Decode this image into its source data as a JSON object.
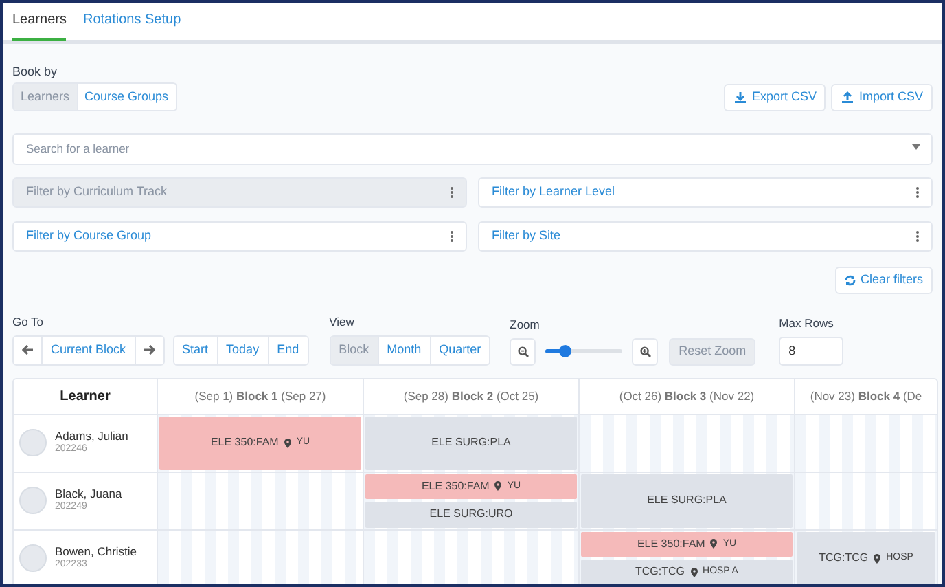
{
  "tabs": [
    {
      "label": "Learners",
      "selected": true
    },
    {
      "label": "Rotations Setup",
      "selected": false
    }
  ],
  "book_by": {
    "label": "Book by",
    "options": [
      {
        "label": "Learners",
        "selected": true
      },
      {
        "label": "Course Groups",
        "selected": false
      }
    ]
  },
  "actions": [
    "Export CSV",
    "Import CSV"
  ],
  "search": {
    "placeholder": "Search for a learner"
  },
  "filters": [
    {
      "label": "Filter by Curriculum Track",
      "disabled": true
    },
    {
      "label": "Filter by Learner Level",
      "disabled": false
    },
    {
      "label": "Filter by Course Group",
      "disabled": false
    },
    {
      "label": "Filter by Site",
      "disabled": false
    }
  ],
  "clear_filters": "Clear filters",
  "go_to": {
    "label": "Go To",
    "current": "Current Block",
    "buttons": [
      "Start",
      "Today",
      "End"
    ]
  },
  "view": {
    "label": "View",
    "options": [
      {
        "label": "Block",
        "selected": true
      },
      {
        "label": "Month",
        "selected": false
      },
      {
        "label": "Quarter",
        "selected": false
      }
    ]
  },
  "zoom": {
    "label": "Zoom",
    "level": 0.25,
    "reset": "Reset Zoom"
  },
  "max_rows": {
    "label": "Max Rows",
    "value": "8"
  },
  "table": {
    "learner_heading": "Learner",
    "blocks": [
      "(Sep 1) **Block 1** (Sep 27)",
      "(Sep 28) **Block 2** (Oct 25)",
      "(Oct 26) **Block 3** (Nov 22)",
      "(Nov 23) **Block 4** (De"
    ],
    "rows": [
      {
        "name": "Adams, Julian",
        "id": "202246",
        "cells": [
          [
            {
              "course": "ELE 350:FAM",
              "site": "YU",
              "color": "#f5baba"
            }
          ],
          [
            {
              "course": "ELE SURG:PLA",
              "color": "#dee2e9"
            }
          ],
          [],
          []
        ]
      },
      {
        "name": "Black, Juana",
        "id": "202249",
        "cells": [
          [],
          [
            {
              "course": "ELE 350:FAM",
              "site": "YU",
              "color": "#f5baba"
            },
            {
              "course": "ELE SURG:URO",
              "color": "#dee2e9"
            }
          ],
          [
            {
              "course": "ELE SURG:PLA",
              "color": "#dee2e9"
            }
          ],
          []
        ]
      },
      {
        "name": "Bowen, Christie",
        "id": "202233",
        "cells": [
          [],
          [],
          [
            {
              "course": "ELE 350:FAM",
              "site": "YU",
              "color": "#f5baba"
            },
            {
              "course": "TCG:TCG",
              "site": "HOSP A",
              "color": "#dee2e9"
            }
          ],
          [
            {
              "course": "TCG:TCG",
              "site": "HOSP",
              "color": "#dee2e9"
            }
          ]
        ]
      }
    ]
  }
}
